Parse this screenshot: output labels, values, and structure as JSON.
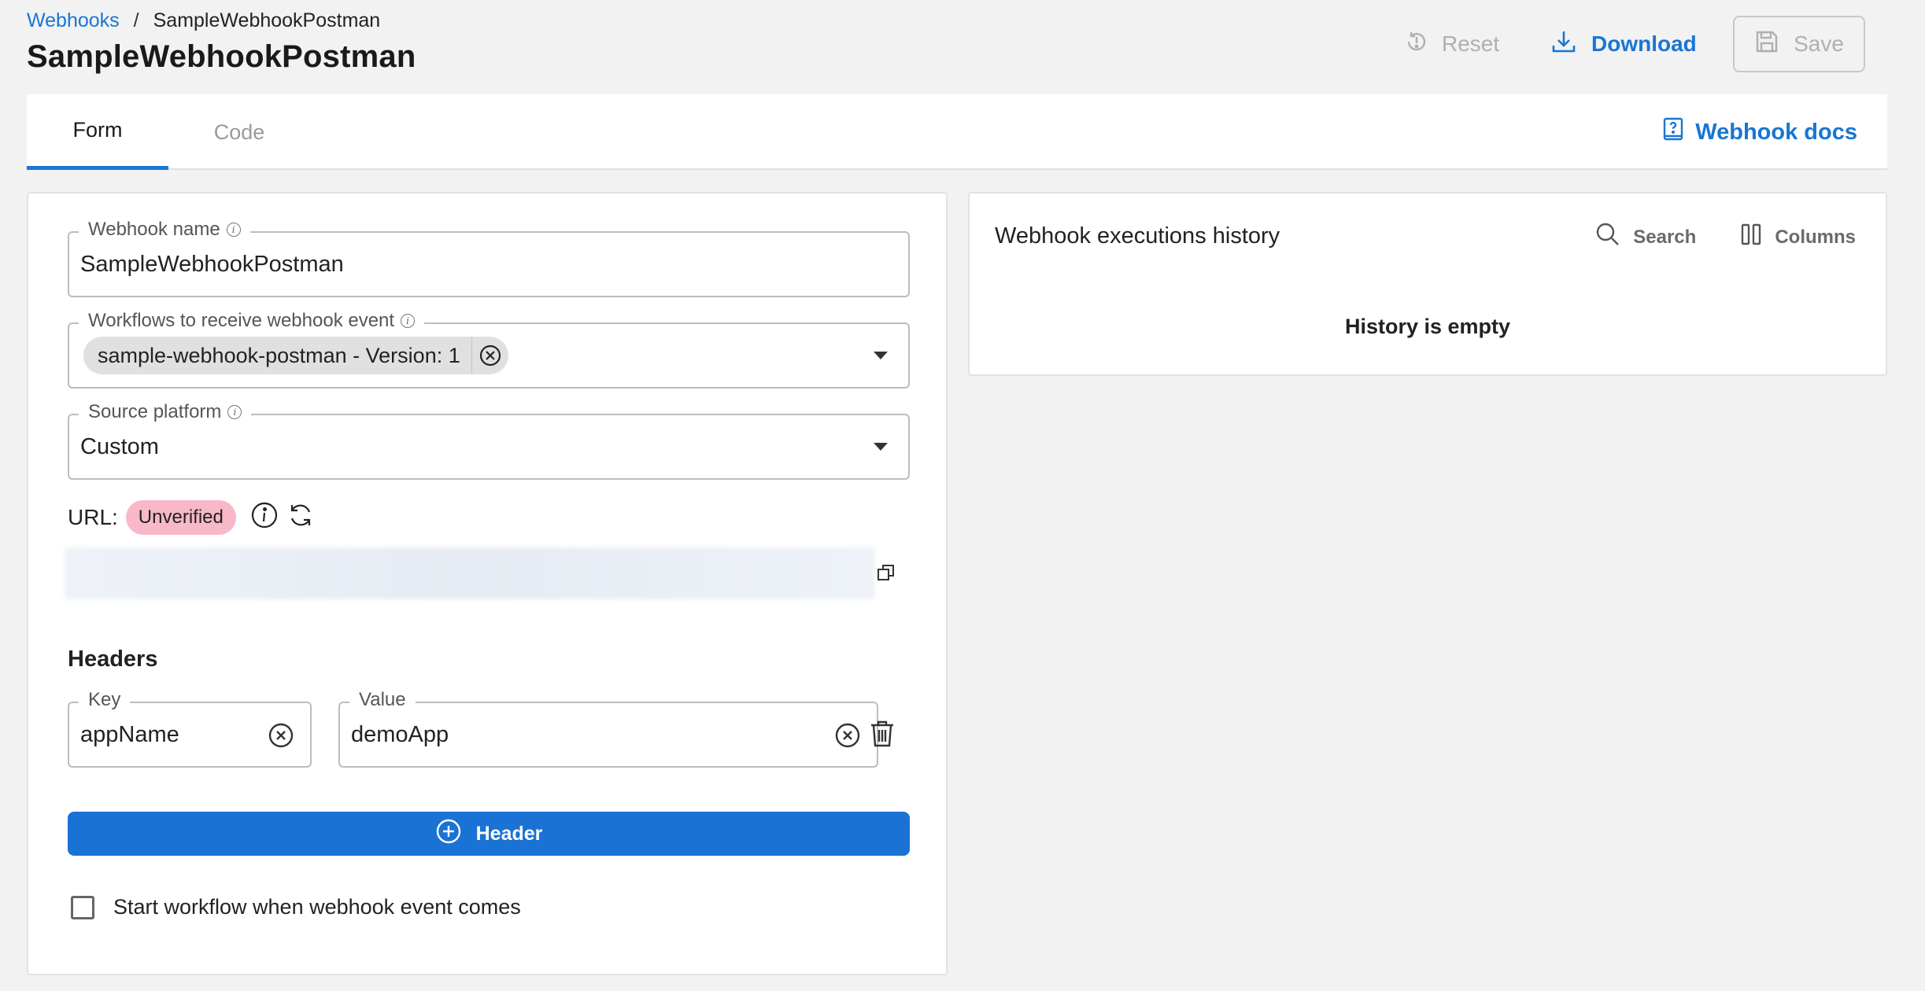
{
  "breadcrumb": {
    "parent": "Webhooks",
    "separator": "/",
    "current": "SampleWebhookPostman"
  },
  "page_title": "SampleWebhookPostman",
  "toolbar": {
    "reset_label": "Reset",
    "download_label": "Download",
    "save_label": "Save"
  },
  "tabs": [
    {
      "label": "Form",
      "active": true
    },
    {
      "label": "Code",
      "active": false
    }
  ],
  "docs_link": "Webhook docs",
  "form": {
    "webhook_name": {
      "label": "Webhook name",
      "value": "SampleWebhookPostman"
    },
    "workflows": {
      "label": "Workflows to receive webhook event",
      "chips": [
        "sample-webhook-postman - Version: 1"
      ]
    },
    "source_platform": {
      "label": "Source platform",
      "value": "Custom"
    },
    "url": {
      "label": "URL:",
      "status": "Unverified"
    },
    "headers": {
      "title": "Headers",
      "key_label": "Key",
      "value_label": "Value",
      "rows": [
        {
          "key": "appName",
          "value": "demoApp"
        }
      ]
    },
    "add_header_label": "Header",
    "start_workflow": {
      "label": "Start workflow when webhook event comes",
      "checked": false
    }
  },
  "history": {
    "title": "Webhook executions history",
    "search_label": "Search",
    "columns_label": "Columns",
    "empty_text": "History is empty"
  },
  "colors": {
    "primary": "#1976d2",
    "badge_unverified": "#f8b8c8",
    "disabled": "#b0b0b0"
  }
}
